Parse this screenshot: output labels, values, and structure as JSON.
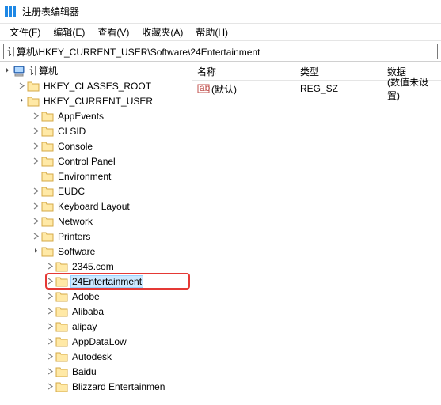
{
  "window": {
    "title": "注册表编辑器"
  },
  "menu": {
    "file": "文件(F)",
    "edit": "编辑(E)",
    "view": "查看(V)",
    "fav": "收藏夹(A)",
    "help": "帮助(H)"
  },
  "address": "计算机\\HKEY_CURRENT_USER\\Software\\24Entertainment",
  "tree": {
    "root": "计算机",
    "hkcr": "HKEY_CLASSES_ROOT",
    "hkcu": "HKEY_CURRENT_USER",
    "items": {
      "appevents": "AppEvents",
      "clsid": "CLSID",
      "console": "Console",
      "controlpanel": "Control Panel",
      "environment": "Environment",
      "eudc": "EUDC",
      "keyboard": "Keyboard Layout",
      "network": "Network",
      "printers": "Printers",
      "software": "Software",
      "s2345": "2345.com",
      "s24ent": "24Entertainment",
      "adobe": "Adobe",
      "alibaba": "Alibaba",
      "alipay": "alipay",
      "appdatalow": "AppDataLow",
      "autodesk": "Autodesk",
      "baidu": "Baidu",
      "blizzard": "Blizzard Entertainmen"
    }
  },
  "list": {
    "headers": {
      "name": "名称",
      "type": "类型",
      "data": "数据"
    },
    "row0": {
      "name": "(默认)",
      "type": "REG_SZ",
      "data": "(数值未设置)"
    }
  }
}
